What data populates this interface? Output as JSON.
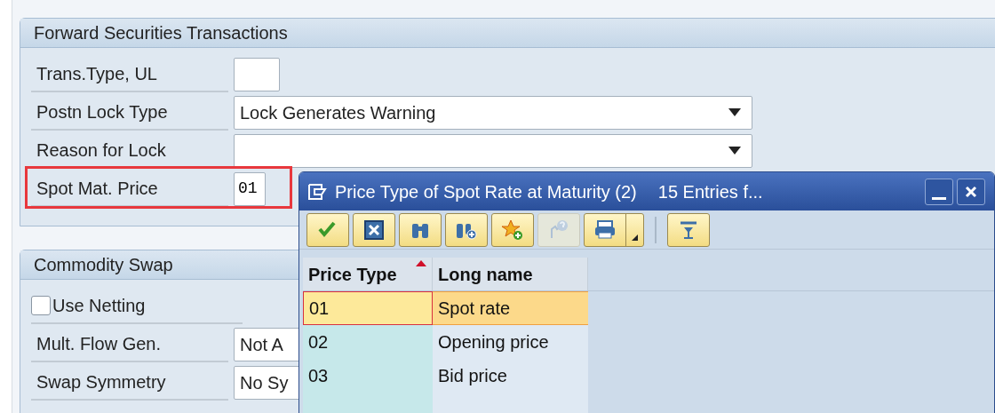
{
  "panels": [
    {
      "title": "Forward Securities Transactions",
      "fields": [
        {
          "kind": "input",
          "label": "Trans.Type, UL",
          "highlighted": false
        },
        {
          "kind": "dropdown",
          "label": "Postn Lock Type",
          "value": "Lock Generates Warning",
          "highlighted": false
        },
        {
          "kind": "dropdown",
          "label": "Reason for Lock",
          "highlighted": false
        },
        {
          "kind": "input",
          "label": "Spot Mat. Price",
          "value": "01",
          "highlighted": true
        }
      ]
    },
    {
      "title": "Commodity Swap",
      "fields": [
        {
          "kind": "checkbox",
          "label": "Use Netting",
          "checked": false,
          "highlighted": false
        },
        {
          "kind": "wide-input",
          "label": "Mult. Flow Gen.",
          "value": "Not A",
          "highlighted": false
        },
        {
          "kind": "wide-input",
          "label": "Swap Symmetry",
          "value": "No Sy",
          "highlighted": false
        }
      ]
    }
  ],
  "popup": {
    "title": "Price Type of Spot Rate at Maturity (2)",
    "subtitle": "15 Entries f...",
    "toolbar": [
      {
        "kind": "check",
        "disabled": false
      },
      {
        "kind": "cancel",
        "disabled": false
      },
      {
        "kind": "find",
        "disabled": false
      },
      {
        "kind": "find-next",
        "disabled": false
      },
      {
        "kind": "favorite-add",
        "disabled": false
      },
      {
        "kind": "help",
        "disabled": true
      },
      {
        "kind": "print",
        "disabled": false
      },
      {
        "kind": "separator"
      },
      {
        "kind": "filter",
        "disabled": false
      }
    ],
    "table": {
      "columns": [
        {
          "label": "Price Type",
          "sorted": true
        },
        {
          "label": "Long name",
          "sorted": false
        }
      ],
      "rows": [
        {
          "cells": [
            "01",
            "Spot rate"
          ],
          "selected": true
        },
        {
          "cells": [
            "02",
            "Opening price"
          ],
          "selected": false
        },
        {
          "cells": [
            "03",
            "Bid price"
          ],
          "selected": false
        }
      ]
    }
  }
}
